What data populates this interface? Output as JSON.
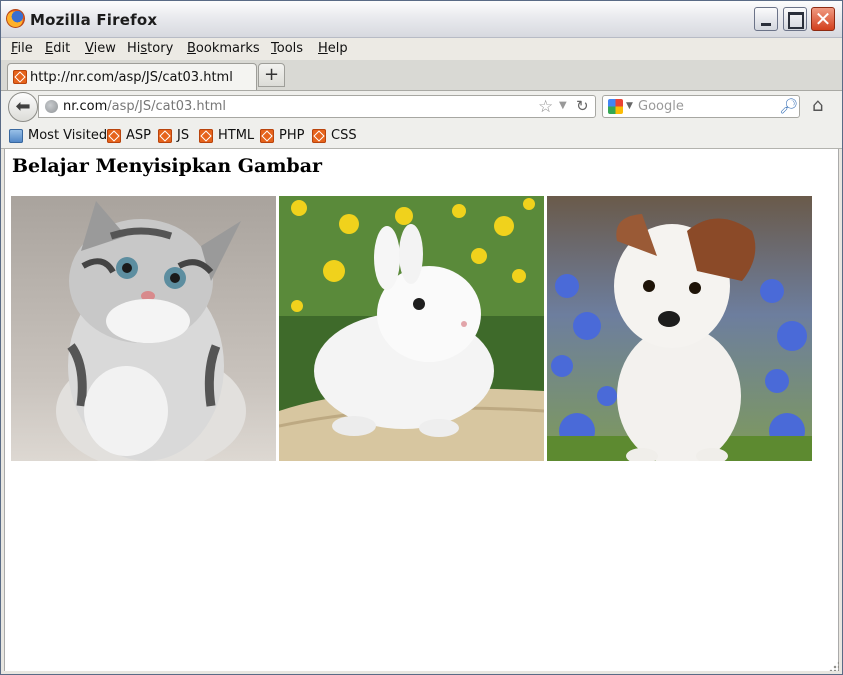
{
  "window": {
    "title": "Mozilla Firefox"
  },
  "menu": {
    "items": [
      {
        "first": "F",
        "rest": "ile"
      },
      {
        "first": "E",
        "rest": "dit"
      },
      {
        "first": "V",
        "rest": "iew"
      },
      {
        "first": "Hi",
        "rest": "story",
        "underline_index": 2
      },
      {
        "first": "B",
        "rest": "ookmarks"
      },
      {
        "first": "T",
        "rest": "ools"
      },
      {
        "first": "H",
        "rest": "elp"
      }
    ]
  },
  "tab": {
    "label": "http://nr.com/asp/JS/cat03.html",
    "new_tab": "+"
  },
  "urlbar": {
    "host": "nr.com",
    "path": "/asp/JS/cat03.html"
  },
  "search": {
    "placeholder": "Google"
  },
  "bookmarks": {
    "most_visited": "Most Visited",
    "items": [
      "ASP",
      "JS",
      "HTML",
      "PHP",
      "CSS"
    ]
  },
  "page": {
    "heading": "Belajar Menyisipkan Gambar"
  },
  "icons": {
    "back": "back-arrow-icon",
    "star": "star-icon",
    "reload": "reload-icon",
    "home": "home-icon",
    "search": "magnifier-icon",
    "favicon": "xampp-favicon-icon"
  }
}
